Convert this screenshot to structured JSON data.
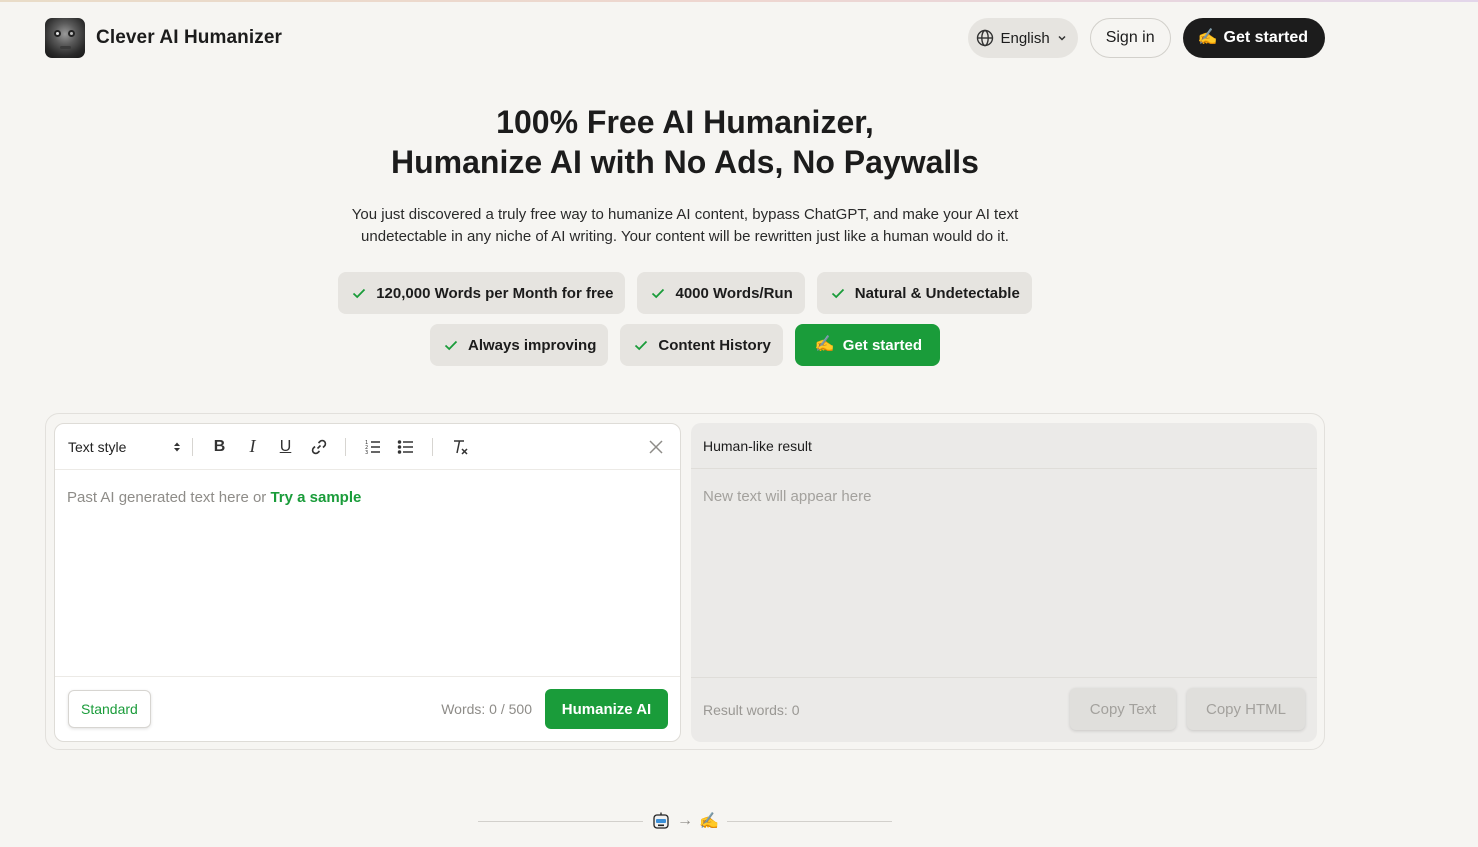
{
  "header": {
    "brand_name": "Clever AI Humanizer",
    "language": "English",
    "sign_in": "Sign in",
    "get_started": "Get started"
  },
  "hero": {
    "title_line1": "100% Free AI Humanizer,",
    "title_line2": "Humanize AI with No Ads, No Paywalls",
    "subtitle_line1": "You just discovered a truly free way to humanize AI content, bypass ChatGPT, and make your AI text",
    "subtitle_line2": "undetectable in any niche of AI writing. Your content will be rewritten just like a human would do it."
  },
  "features": [
    "120,000 Words per Month for free",
    "4000 Words/Run",
    "Natural & Undetectable",
    "Always improving",
    "Content History"
  ],
  "cta": {
    "label": "Get started"
  },
  "editor": {
    "text_style": "Text style",
    "placeholder_prefix": "Past AI generated text here or",
    "try_sample": "Try a sample",
    "mode": "Standard",
    "word_count": "Words: 0 / 500",
    "humanize_button": "Humanize AI"
  },
  "result": {
    "title": "Human-like result",
    "placeholder": "New text will appear here",
    "word_count": "Result words: 0",
    "copy_text": "Copy Text",
    "copy_html": "Copy HTML"
  },
  "transition": {
    "arrow": "→"
  },
  "colors": {
    "accent_green": "#1a9c3a",
    "dark": "#1c1c1c",
    "background": "#f6f5f2",
    "chip_bg": "#e6e4e0"
  },
  "icons": {
    "hand": "writing-hand-icon",
    "check": "check-icon",
    "globe": "globe-icon",
    "robot": "robot-icon"
  }
}
